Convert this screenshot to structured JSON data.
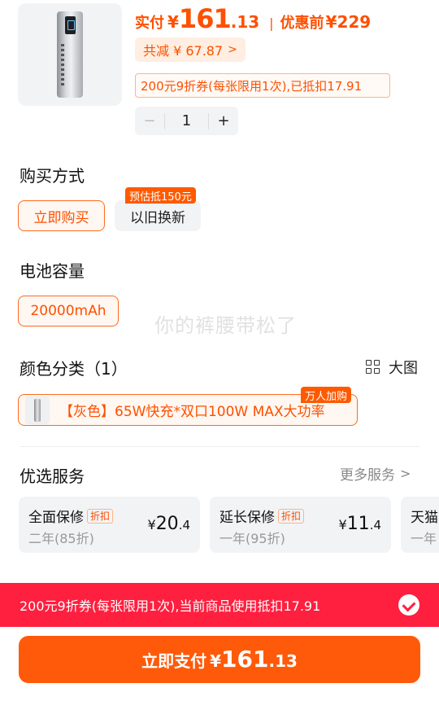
{
  "product": {
    "thumbnail_icon": "power-bank-image",
    "actual_price_label": "实付",
    "currency": "¥",
    "actual_price_int": "161",
    "actual_price_dec": ".13",
    "separator": "|",
    "before_label": "优惠前",
    "before_price": "¥229",
    "total_reduction": "共减 ¥ 67.87",
    "reduction_chevron": ">",
    "coupon_tag": "200元9折券(每张限用1次),已抵扣17.91",
    "quantity": {
      "minus": "−",
      "value": "1",
      "plus": "+"
    }
  },
  "purchase_method": {
    "title": "购买方式",
    "options": [
      {
        "label": "立即购买",
        "selected": true
      },
      {
        "label": "以旧换新",
        "selected": false,
        "badge": "预估抵150元"
      }
    ]
  },
  "battery": {
    "title": "电池容量",
    "options": [
      {
        "label": "20000mAh",
        "selected": true
      }
    ]
  },
  "watermark": "你的裤腰带松了",
  "color": {
    "title": "颜色分类（1）",
    "big_picture_label": "大图",
    "option": {
      "label": "【灰色】65W快充*双口100W MAX大功率",
      "badge": "万人加购",
      "selected": true
    }
  },
  "services": {
    "title": "优选服务",
    "more_label": "更多服务",
    "more_chevron": ">",
    "items": [
      {
        "name": "全面保修",
        "tag": "折扣",
        "sub": "二年(85折)",
        "currency": "¥",
        "price_int": "20",
        "price_dec": ".4"
      },
      {
        "name": "延长保修",
        "tag": "折扣",
        "sub": "一年(95折)",
        "currency": "¥",
        "price_int": "11",
        "price_dec": ".4"
      },
      {
        "name": "天猫",
        "tag": "",
        "sub": "一年",
        "currency": "",
        "price_int": "",
        "price_dec": ""
      }
    ]
  },
  "coupon_bar": {
    "text": "200元9折券(每张限用1次),当前商品使用抵扣17.91",
    "checked": true
  },
  "pay_button": {
    "label": "立即支付",
    "currency": "¥",
    "price_int": "161",
    "price_dec": ".13"
  },
  "colors": {
    "accent": "#ff5000",
    "coupon_bar_bg": "#ff1f3f",
    "pay_button_bg": "#ff5a0a"
  }
}
